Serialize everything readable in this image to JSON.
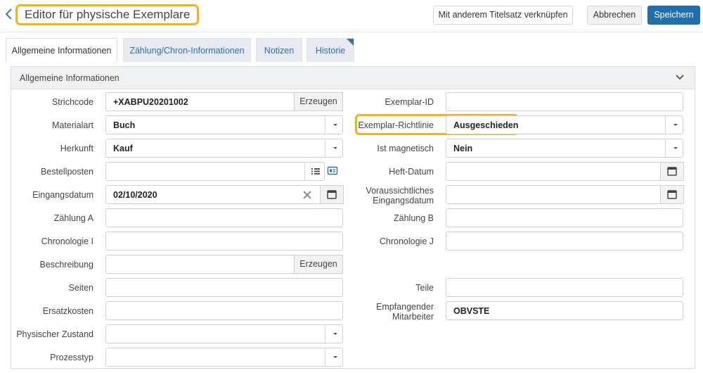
{
  "header": {
    "title": "Editor für physische Exemplare",
    "link_label": "Mit anderem Titelsatz verknüpfen",
    "cancel_label": "Abbrechen",
    "save_label": "Speichern"
  },
  "tabs": [
    {
      "label": "Allgemeine Informationen",
      "active": true
    },
    {
      "label": "Zählung/Chron-Informationen",
      "active": false
    },
    {
      "label": "Notizen",
      "active": false
    },
    {
      "label": "Historie",
      "active": false
    }
  ],
  "panel": {
    "title": "Allgemeine Informationen"
  },
  "left": {
    "strichcode": {
      "label": "Strichcode",
      "value": "+XABPU20201002",
      "button": "Erzeugen"
    },
    "materialart": {
      "label": "Materialart",
      "value": "Buch"
    },
    "herkunft": {
      "label": "Herkunft",
      "value": "Kauf"
    },
    "bestellposten": {
      "label": "Bestellposten",
      "value": ""
    },
    "eingangsdatum": {
      "label": "Eingangsdatum",
      "value": "02/10/2020"
    },
    "zaehlung_a": {
      "label": "Zählung A",
      "value": ""
    },
    "chronologie_i": {
      "label": "Chronologie I",
      "value": ""
    },
    "beschreibung": {
      "label": "Beschreibung",
      "value": "",
      "button": "Erzeugen"
    },
    "seiten": {
      "label": "Seiten",
      "value": ""
    },
    "ersatzkosten": {
      "label": "Ersatzkosten",
      "value": ""
    },
    "zustand": {
      "label": "Physischer Zustand",
      "value": ""
    },
    "prozesstyp": {
      "label": "Prozesstyp",
      "value": ""
    }
  },
  "right": {
    "exemplar_id": {
      "label": "Exemplar-ID",
      "value": ""
    },
    "richtlinie": {
      "label": "Exemplar-Richtlinie",
      "value": "Ausgeschieden"
    },
    "magnetisch": {
      "label": "Ist magnetisch",
      "value": "Nein"
    },
    "heft_datum": {
      "label": "Heft-Datum",
      "value": ""
    },
    "vor_eingang_1": "Voraussichtliches",
    "vor_eingang_2": "Eingangsdatum",
    "zaehlung_b": {
      "label": "Zählung B",
      "value": ""
    },
    "chronologie_j": {
      "label": "Chronologie J",
      "value": ""
    },
    "teile": {
      "label": "Teile",
      "value": ""
    },
    "mitarbeiter_1": "Empfangender",
    "mitarbeiter_2": "Mitarbeiter",
    "mitarbeiter_value": "OBVSTE"
  },
  "colors": {
    "highlight": "#f2b21b",
    "primary": "#1f6fad",
    "tab_link": "#2e6fa8"
  }
}
